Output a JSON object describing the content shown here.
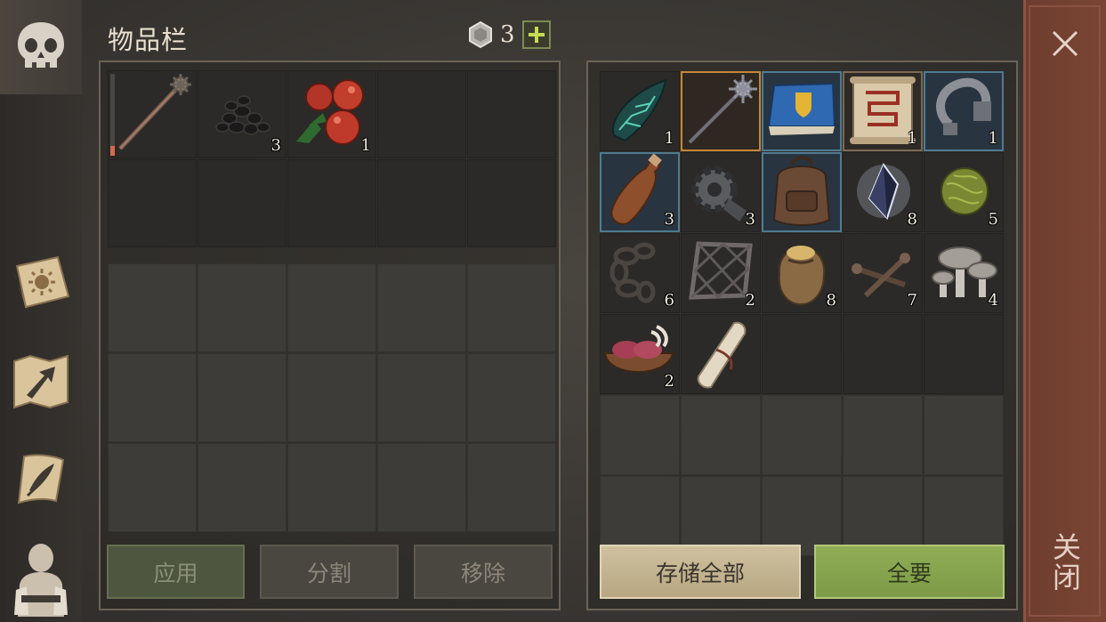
{
  "header": {
    "title": "物品栏",
    "currency_icon": "silver-coin-icon",
    "currency_count": "3",
    "add_icon": "plus-icon"
  },
  "sidebar": {
    "tabs": [
      {
        "icon": "skull-icon",
        "active": true
      },
      {
        "icon": "sun-book-icon",
        "active": false
      },
      {
        "icon": "map-arrow-icon",
        "active": false
      },
      {
        "icon": "scroll-quill-icon",
        "active": false
      },
      {
        "icon": "character-backpack-icon",
        "active": false
      }
    ]
  },
  "inventory": {
    "slots": [
      {
        "item": "mace",
        "count": "",
        "durability": 0.12
      },
      {
        "item": "coal",
        "count": "3"
      },
      {
        "item": "berries",
        "count": "1"
      },
      {
        "item": "",
        "count": ""
      },
      {
        "item": "",
        "count": ""
      },
      {
        "item": "",
        "count": ""
      },
      {
        "item": "",
        "count": ""
      },
      {
        "item": "",
        "count": ""
      },
      {
        "item": "",
        "count": ""
      },
      {
        "item": "",
        "count": ""
      }
    ],
    "buttons": {
      "apply": "应用",
      "split": "分割",
      "remove": "移除"
    }
  },
  "storage": {
    "slots": [
      {
        "item": "crystal-shard",
        "count": "1"
      },
      {
        "item": "spiked-mace",
        "count": ""
      },
      {
        "item": "blue-book",
        "count": ""
      },
      {
        "item": "recipe-scroll",
        "count": "1"
      },
      {
        "item": "iron-hook",
        "count": "1"
      },
      {
        "item": "leather-flask",
        "count": "3"
      },
      {
        "item": "gear-part",
        "count": "3"
      },
      {
        "item": "backpack",
        "count": ""
      },
      {
        "item": "dark-crystal",
        "count": "8"
      },
      {
        "item": "herb-ball",
        "count": "5"
      },
      {
        "item": "chain",
        "count": "6"
      },
      {
        "item": "iron-grate",
        "count": "2"
      },
      {
        "item": "grain-sack",
        "count": "8"
      },
      {
        "item": "nails",
        "count": "7"
      },
      {
        "item": "mushrooms",
        "count": "4"
      },
      {
        "item": "meat-bowl",
        "count": "2"
      },
      {
        "item": "paper-roll",
        "count": ""
      }
    ],
    "buttons": {
      "store_all": "存储全部",
      "take_all": "全要"
    }
  },
  "close": {
    "label": "关闭",
    "icon": "close-icon"
  }
}
